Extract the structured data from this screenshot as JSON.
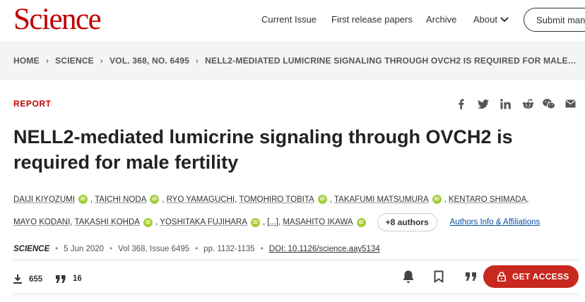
{
  "site": {
    "logo": "Science"
  },
  "nav": {
    "current_issue": "Current Issue",
    "first_release": "First release papers",
    "archive": "Archive",
    "about": "About",
    "submit": "Submit manuscript"
  },
  "breadcrumb": [
    "HOME",
    "SCIENCE",
    "VOL. 368, NO. 6495",
    "NELL2-MEDIATED LUMICRINE SIGNALING THROUGH OVCH2 IS REQUIRED FOR MALE…"
  ],
  "article": {
    "type": "REPORT",
    "title": "NELL2-mediated lumicrine signaling through OVCH2 is required for male fertility",
    "authors_line1": [
      {
        "name": "DAIJI KIYOZUMI",
        "orcid": true
      },
      {
        "name": "TAICHI NODA",
        "orcid": true
      },
      {
        "name": "RYO YAMAGUCHI",
        "orcid": false
      },
      {
        "name": "TOMOHIRO TOBITA",
        "orcid": true
      },
      {
        "name": "TAKAFUMI MATSUMURA",
        "orcid": true
      },
      {
        "name": "KENTARO SHIMADA",
        "orcid": false
      }
    ],
    "authors_line2": [
      {
        "name": "MAYO KODANI",
        "orcid": false
      },
      {
        "name": "TAKASHI KOHDA",
        "orcid": true
      },
      {
        "name": "YOSHITAKA FUJIHARA",
        "orcid": true
      },
      {
        "name": "[...]",
        "orcid": false
      },
      {
        "name": "MASAHITO IKAWA",
        "orcid": true
      }
    ],
    "orcid_label": "iD",
    "more_authors": "+8 authors",
    "affiliations": "Authors Info & Affiliations",
    "journal": "SCIENCE",
    "date": "5 Jun 2020",
    "volume": "Vol 368, Issue 6495",
    "pages": "pp. 1132-1135",
    "doi": "DOI: 10.1126/science.aay5134"
  },
  "metrics": {
    "downloads": "655",
    "citations": "16"
  },
  "actions": {
    "get_access": "GET ACCESS"
  },
  "share_icons": [
    "facebook-icon",
    "twitter-icon",
    "linkedin-icon",
    "reddit-icon",
    "wechat-icon",
    "email-icon"
  ],
  "colors": {
    "brand": "#c00000",
    "access_button": "#c8281e",
    "orcid": "#a6ce39",
    "link": "#0a4fa0",
    "band": "#f4f4f4"
  }
}
